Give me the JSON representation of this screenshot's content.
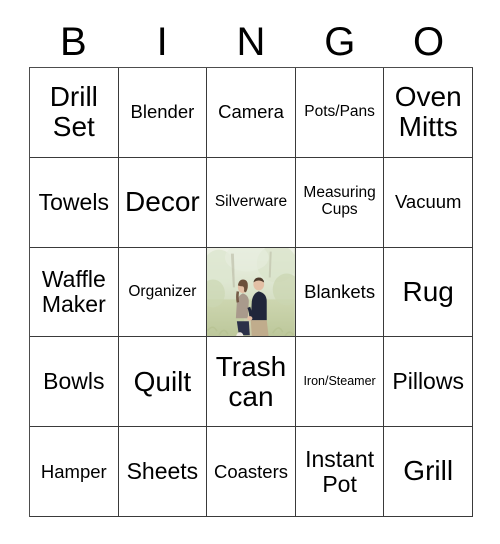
{
  "card": {
    "header_letters": [
      "B",
      "I",
      "N",
      "G",
      "O"
    ],
    "rows": [
      [
        {
          "label": "Drill Set",
          "size": "xl"
        },
        {
          "label": "Blender",
          "size": "m"
        },
        {
          "label": "Camera",
          "size": "m"
        },
        {
          "label": "Pots/Pans",
          "size": "s"
        },
        {
          "label": "Oven Mitts",
          "size": "xl"
        }
      ],
      [
        {
          "label": "Towels",
          "size": "l"
        },
        {
          "label": "Decor",
          "size": "xl"
        },
        {
          "label": "Silverware",
          "size": "s"
        },
        {
          "label": "Measuring Cups",
          "size": "s"
        },
        {
          "label": "Vacuum",
          "size": "m"
        }
      ],
      [
        {
          "label": "Waffle Maker",
          "size": "l"
        },
        {
          "label": "Organizer",
          "size": "s"
        },
        {
          "label": "",
          "size": "m",
          "type": "photo",
          "photo_alt": "couple-in-field-photo"
        },
        {
          "label": "Blankets",
          "size": "m"
        },
        {
          "label": "Rug",
          "size": "xl"
        }
      ],
      [
        {
          "label": "Bowls",
          "size": "l"
        },
        {
          "label": "Quilt",
          "size": "xl"
        },
        {
          "label": "Trash can",
          "size": "xl"
        },
        {
          "label": "Iron/Steamer",
          "size": "xs"
        },
        {
          "label": "Pillows",
          "size": "l"
        }
      ],
      [
        {
          "label": "Hamper",
          "size": "m"
        },
        {
          "label": "Sheets",
          "size": "l"
        },
        {
          "label": "Coasters",
          "size": "m"
        },
        {
          "label": "Instant Pot",
          "size": "l"
        },
        {
          "label": "Grill",
          "size": "xl"
        }
      ]
    ]
  },
  "colors": {
    "background": "#ffffff",
    "text": "#000000",
    "grid_line": "#3a3a3a",
    "photo_grass": "#c8d1ae",
    "photo_foliage": "#dce5cf",
    "photo_navy": "#20263a",
    "photo_khaki": "#c0ac8c",
    "photo_taupe": "#a99a8c",
    "photo_denim": "#2b3048",
    "photo_skin": "#e3bfa5"
  }
}
